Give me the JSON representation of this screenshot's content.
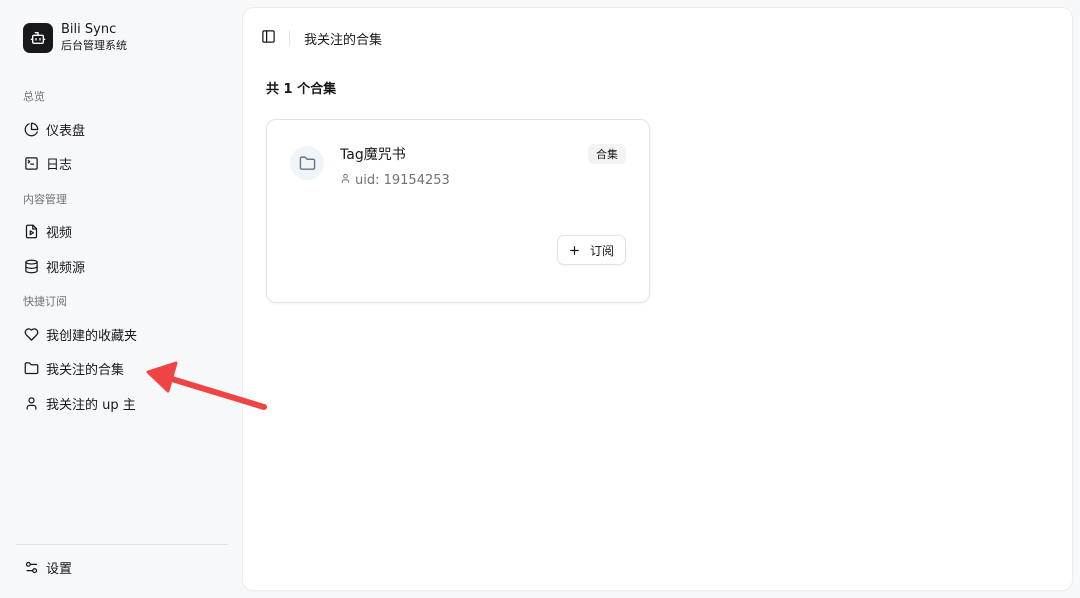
{
  "brand": {
    "name": "Bili Sync",
    "subtitle": "后台管理系统",
    "logo_icon": "bot-icon"
  },
  "sidebar": {
    "groups": [
      {
        "label": "总览",
        "items": [
          {
            "label": "仪表盘",
            "icon": "pie-chart-icon"
          },
          {
            "label": "日志",
            "icon": "terminal-icon"
          }
        ]
      },
      {
        "label": "内容管理",
        "items": [
          {
            "label": "视频",
            "icon": "file-video-icon"
          },
          {
            "label": "视频源",
            "icon": "database-icon"
          }
        ]
      },
      {
        "label": "快捷订阅",
        "items": [
          {
            "label": "我创建的收藏夹",
            "icon": "heart-icon"
          },
          {
            "label": "我关注的合集",
            "icon": "folder-icon"
          },
          {
            "label": "我关注的 up 主",
            "icon": "user-icon"
          }
        ]
      }
    ],
    "footer": {
      "label": "设置",
      "icon": "settings-sliders-icon"
    }
  },
  "header": {
    "title": "我关注的合集",
    "toggle_icon": "panel-left-icon"
  },
  "main": {
    "count_text": "共 1 个合集"
  },
  "cards": [
    {
      "title": "Tag魔咒书",
      "uid": "uid: 19154253",
      "badge": "合集",
      "button_label": "订阅",
      "icon": "folder-icon"
    }
  ],
  "colors": {
    "background": "#f7f8fa",
    "panel": "#ffffff",
    "text": "#18181b",
    "muted": "#71717a",
    "annotation": "#ef4444"
  }
}
